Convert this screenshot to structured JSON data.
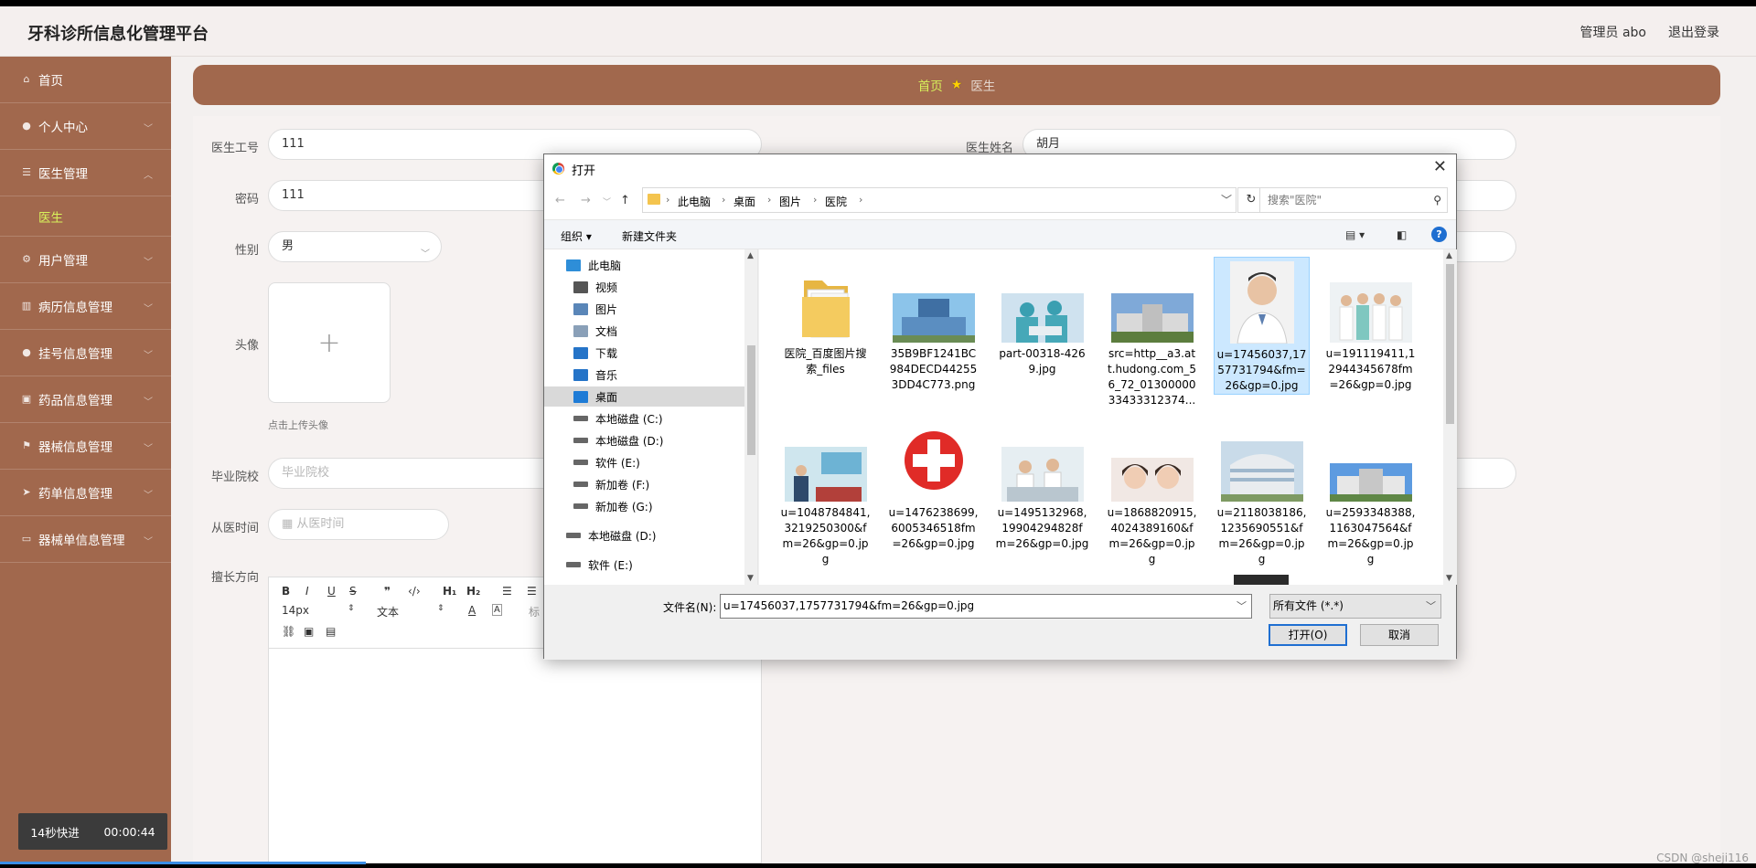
{
  "header": {
    "title": "牙科诊所信息化管理平台",
    "user": "管理员 abo",
    "logout": "退出登录"
  },
  "sidebar": {
    "items": [
      {
        "label": "首页",
        "icon": "home-icon"
      },
      {
        "label": "个人中心",
        "icon": "user-icon"
      },
      {
        "label": "医生管理",
        "icon": "list-icon"
      },
      {
        "label": "用户管理",
        "icon": "settings-icon"
      },
      {
        "label": "病历信息管理",
        "icon": "chart-icon"
      },
      {
        "label": "挂号信息管理",
        "icon": "person-icon"
      },
      {
        "label": "药品信息管理",
        "icon": "box-icon"
      },
      {
        "label": "器械信息管理",
        "icon": "flag-icon"
      },
      {
        "label": "药单信息管理",
        "icon": "send-icon"
      },
      {
        "label": "器械单信息管理",
        "icon": "message-icon"
      }
    ],
    "sub_item": "医生",
    "clock_label": "14秒快进",
    "clock_time": "00:00:44"
  },
  "breadcrumb": {
    "home": "首页",
    "current": "医生"
  },
  "form": {
    "doctor_id_label": "医生工号",
    "doctor_id_value": "111",
    "doctor_name_label": "医生姓名",
    "doctor_name_value": "胡月",
    "password_label": "密码",
    "password_value": "111",
    "gender_label": "性别",
    "gender_value": "男",
    "avatar_label": "头像",
    "avatar_tip": "点击上传头像",
    "school_label": "毕业院校",
    "school_placeholder": "毕业院校",
    "work_time_label": "从医时间",
    "work_time_placeholder": "从医时间",
    "specialty_label": "擅长方向",
    "editor_font_size": "14px",
    "editor_text_type": "文本",
    "editor_heading": "标"
  },
  "dialog": {
    "title": "打开",
    "path": [
      "此电脑",
      "桌面",
      "图片",
      "医院"
    ],
    "search_placeholder": "搜索\"医院\"",
    "organize": "组织 ▾",
    "new_folder": "新建文件夹",
    "tree": [
      {
        "label": "此电脑",
        "color": "#2e8ed8"
      },
      {
        "label": "视频",
        "color": "#555"
      },
      {
        "label": "图片",
        "color": "#5a86b8"
      },
      {
        "label": "文档",
        "color": "#8aa0b8"
      },
      {
        "label": "下载",
        "color": "#2574c8"
      },
      {
        "label": "音乐",
        "color": "#2574c8"
      },
      {
        "label": "桌面",
        "color": "#1e7bd6"
      },
      {
        "label": "本地磁盘 (C:)",
        "color": "#666"
      },
      {
        "label": "本地磁盘 (D:)",
        "color": "#666"
      },
      {
        "label": "软件 (E:)",
        "color": "#666"
      },
      {
        "label": "新加卷 (F:)",
        "color": "#666"
      },
      {
        "label": "新加卷 (G:)",
        "color": "#666"
      },
      {
        "label": "本地磁盘 (D:)",
        "color": "#666"
      },
      {
        "label": "软件 (E:)",
        "color": "#666"
      }
    ],
    "files": [
      {
        "name": "医院_百度图片搜\n索_files",
        "kind": "folder"
      },
      {
        "name": "35B9BF1241BC\n984DECD44255\n3DD4C773.png",
        "kind": "building-blue"
      },
      {
        "name": "part-00318-426\n9.jpg",
        "kind": "surgery"
      },
      {
        "name": "src=http__a3.at\nt.hudong.com_5\n6_72_01300000\n33433312374...",
        "kind": "building-long"
      },
      {
        "name": "u=17456037,17\n57731794&fm=\n26&gp=0.jpg",
        "kind": "doctor"
      },
      {
        "name": "u=191119411,1\n2944345678fm\n=26&gp=0.jpg",
        "kind": "team"
      },
      {
        "name": "u=1048784841,\n3219250300&f\nm=26&gp=0.jp\ng",
        "kind": "meeting"
      },
      {
        "name": "u=1476238699,\n6005346518fm\n=26&gp=0.jpg",
        "kind": "redcross"
      },
      {
        "name": "u=1495132968,\n19904294828f\nm=26&gp=0.jpg",
        "kind": "office"
      },
      {
        "name": "u=1868820915,\n4024389160&f\nm=26&gp=0.jp\ng",
        "kind": "faces"
      },
      {
        "name": "u=2118038186,\n1235690551&f\nm=26&gp=0.jp\ng",
        "kind": "building-round"
      },
      {
        "name": "u=2593348388,\n1163047564&f\nm=26&gp=0.jp\ng",
        "kind": "building-wide"
      }
    ],
    "file_name_label": "文件名(N):",
    "file_name_value": "u=17456037,1757731794&fm=26&gp=0.jpg",
    "file_type": "所有文件 (*.*)",
    "open_button": "打开(O)",
    "cancel_button": "取消"
  },
  "watermark": "CSDN @sheji116"
}
